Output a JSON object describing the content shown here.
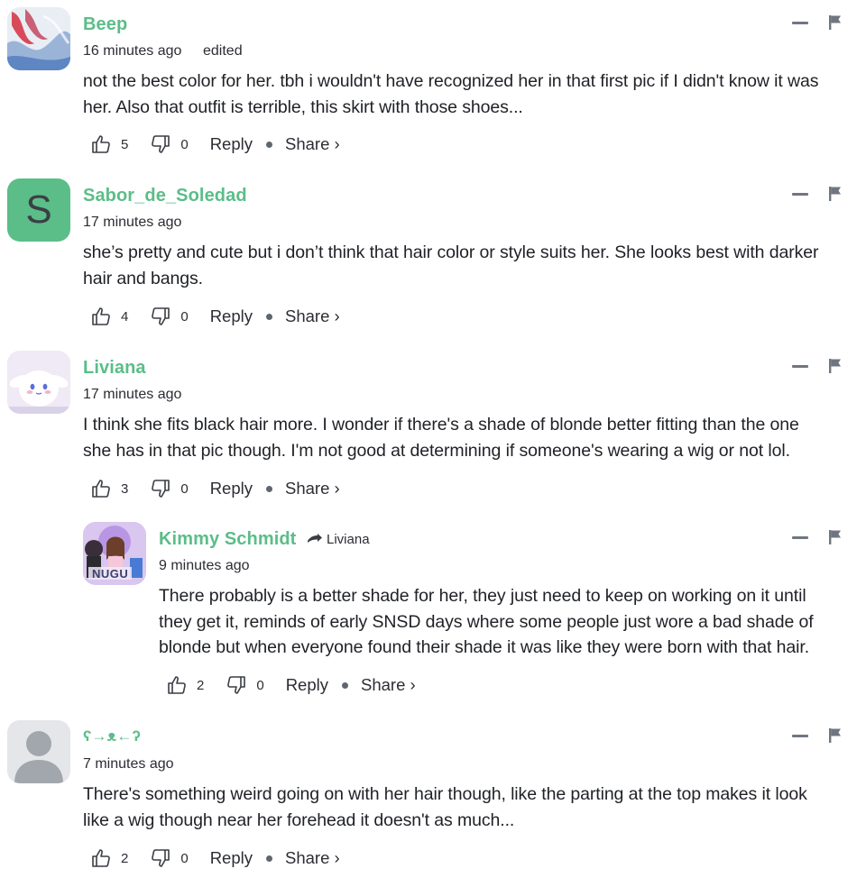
{
  "actions_labels": {
    "reply": "Reply",
    "share": "Share ›"
  },
  "comments": [
    {
      "username": "Beep",
      "timestamp": "16 minutes ago",
      "edited": "edited",
      "text": [
        "not the best color for her. tbh i wouldn't have recognized her in that first pic if I didn't know it was",
        "her. Also that outfit is terrible, this skirt with those shoes..."
      ],
      "likes": "5",
      "dislikes": "0"
    },
    {
      "username": "Sabor_de_Soledad",
      "avatar_letter": "S",
      "timestamp": "17 minutes ago",
      "text": [
        "she’s pretty and cute but i don’t think that hair color or style suits her. She looks best with darker",
        "hair and bangs."
      ],
      "likes": "4",
      "dislikes": "0"
    },
    {
      "username": "Liviana",
      "timestamp": "17 minutes ago",
      "text": [
        "I think she fits black hair more. I wonder if there's a shade of blonde better fitting than the one",
        "she has in that pic though. I'm not good at determining if someone's wearing a wig or not lol."
      ],
      "likes": "3",
      "dislikes": "0"
    },
    {
      "username": "Kimmy Schmidt",
      "reply_to": "Liviana",
      "avatar_text": "NUGU",
      "timestamp": "9 minutes ago",
      "text": [
        "There probably is a better shade for her, they just need to keep on working on it until",
        "they get it, reminds of early SNSD days where some people just wore a bad shade of",
        "blonde but when everyone found their shade it was like they were born with that hair."
      ],
      "likes": "2",
      "dislikes": "0"
    },
    {
      "username": "ʕ→ᴥ←ʔ",
      "timestamp": "7 minutes ago",
      "text": [
        "There's something weird going on with her hair though, like the parting at the top makes it look",
        "like a wig though near her forehead it doesn't as much..."
      ],
      "likes": "2",
      "dislikes": "0"
    }
  ],
  "colors": {
    "username": "#5bbd88",
    "avatar_letter_bg": "#5bbd88",
    "icon_gray": "#6f7680"
  },
  "icons": {
    "like": "thumbs-up-icon",
    "dislike": "thumbs-down-icon",
    "minimize": "minus-icon",
    "flag": "flag-icon",
    "reply_arrow": "reply-arrow-icon",
    "default_avatar": "person-silhouette-icon"
  }
}
